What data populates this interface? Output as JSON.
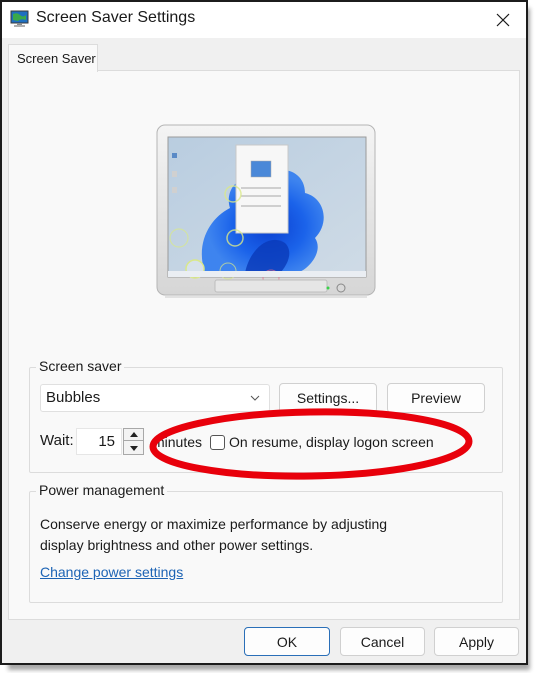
{
  "window": {
    "title": "Screen Saver Settings",
    "icon": "monitor-globe-icon",
    "close_icon": "close-icon"
  },
  "tabs": [
    {
      "label": "Screen Saver",
      "active": true
    }
  ],
  "preview": {
    "description": "Monitor preview showing Windows 11 desktop with bubbles screen saver"
  },
  "screen_saver_group": {
    "label": "Screen saver",
    "selected": "Bubbles",
    "settings_button": "Settings...",
    "preview_button": "Preview",
    "wait_label": "Wait:",
    "wait_value": "15",
    "minutes_label": "minutes",
    "logon_checkbox_label": "On resume, display logon screen",
    "logon_checkbox_checked": false
  },
  "power_group": {
    "label": "Power management",
    "description_line1": "Conserve energy or maximize performance by adjusting",
    "description_line2": "display brightness and other power settings.",
    "link": "Change power settings"
  },
  "footer": {
    "ok": "OK",
    "cancel": "Cancel",
    "apply": "Apply"
  },
  "annotation": {
    "shape": "ellipse",
    "color": "#e8000b",
    "highlights": "logon_checkbox"
  },
  "colors": {
    "link": "#1d64b5",
    "primary_border": "#2a6fb8",
    "panel_bg": "#f9f9f9",
    "window_bg": "#f0f0f0"
  }
}
